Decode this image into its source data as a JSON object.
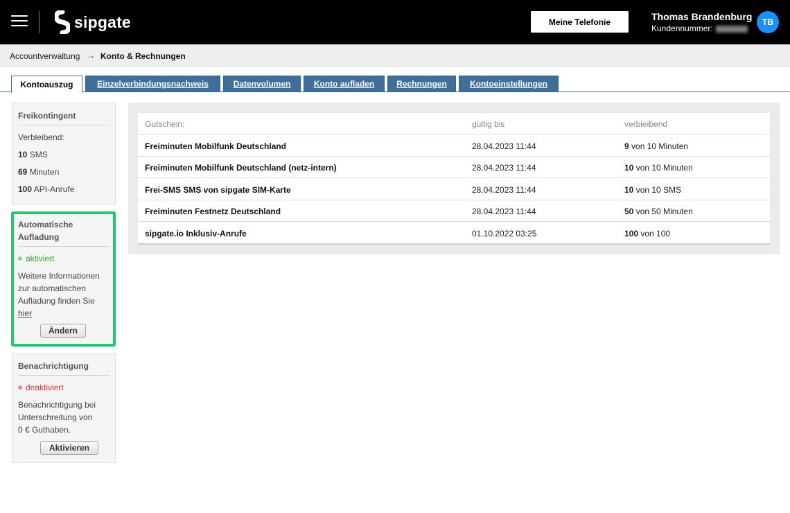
{
  "header": {
    "logo_text": "sipgate",
    "telefonie_button": "Meine Telefonie",
    "user_name": "Thomas Brandenburg",
    "customer_label": "Kundennummer:",
    "avatar_initials": "TB"
  },
  "breadcrumb": {
    "parent": "Accountverwaltung",
    "separator": "→",
    "current": "Konto & Rechnungen"
  },
  "tabs": [
    {
      "label": "Kontoauszug",
      "active": true
    },
    {
      "label": "Einzelverbindungsnachweis",
      "active": false
    },
    {
      "label": "Datenvolumen",
      "active": false
    },
    {
      "label": "Konto aufladen",
      "active": false
    },
    {
      "label": "Rechnungen",
      "active": false
    },
    {
      "label": "Kontoeinstellungen",
      "active": false
    }
  ],
  "sidebar": {
    "freikontingent": {
      "title": "Freikontingent",
      "remaining_label": "Verbleibend:",
      "items": [
        {
          "value": "10",
          "unit": "SMS"
        },
        {
          "value": "69",
          "unit": "Minuten"
        },
        {
          "value": "100",
          "unit": "API-Anrufe"
        }
      ]
    },
    "aufladung": {
      "title_line1": "Automatische",
      "title_line2": "Aufladung",
      "status": "aktiviert",
      "status_color": "#2e9e35",
      "info_line1": "Weitere Informationen",
      "info_line2": "zur automatischen",
      "info_line3": "Aufladung finden Sie",
      "info_link": "hier",
      "button": "Ändern"
    },
    "benachrichtigung": {
      "title": "Benachrichtigung",
      "status": "deaktiviert",
      "status_color": "#e03131",
      "info_line1": "Benachrichtigung bei",
      "info_line2": "Unterschreitung von",
      "info_line3": "0 € Guthaben.",
      "button": "Aktivieren"
    }
  },
  "table": {
    "headers": [
      "Gutschein:",
      "gültig bis",
      "verbleibend"
    ],
    "rows": [
      {
        "name": "Freiminuten Mobilfunk Deutschland",
        "valid_until": "28.04.2023 11:44",
        "remaining": "9",
        "rest": "von 10 Minuten"
      },
      {
        "name": "Freiminuten Mobilfunk Deutschland (netz-intern)",
        "valid_until": "28.04.2023 11:44",
        "remaining": "10",
        "rest": "von 10 Minuten"
      },
      {
        "name": "Frei-SMS SMS von sipgate SIM-Karte",
        "valid_until": "28.04.2023 11:44",
        "remaining": "10",
        "rest": "von 10 SMS"
      },
      {
        "name": "Freiminuten Festnetz Deutschland",
        "valid_until": "28.04.2023 11:44",
        "remaining": "50",
        "rest": "von 50 Minuten"
      },
      {
        "name": "sipgate.io Inklusiv-Anrufe",
        "valid_until": "01.10.2022 03:25",
        "remaining": "100",
        "rest": "von 100"
      }
    ]
  }
}
